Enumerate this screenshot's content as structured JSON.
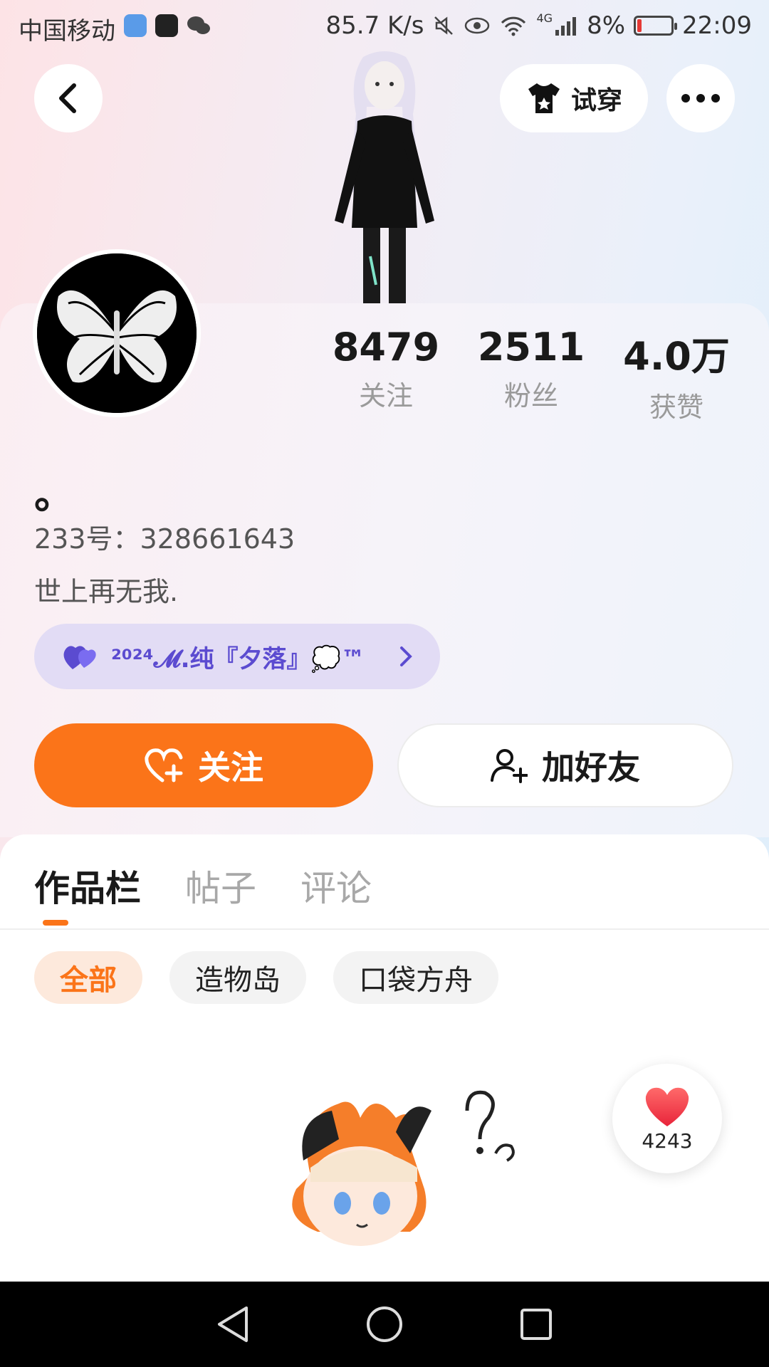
{
  "status_bar": {
    "carrier": "中国移动",
    "net_speed": "85.7 K/s",
    "network": "4G",
    "battery_percent": "8%",
    "battery_level": 0.08,
    "time": "22:09"
  },
  "header": {
    "tryon_label": "试穿"
  },
  "profile": {
    "stats": [
      {
        "value": "8479",
        "label": "关注"
      },
      {
        "value": "2511",
        "label": "粉丝"
      },
      {
        "value": "4.0万",
        "label": "获赞"
      }
    ],
    "username": "。",
    "uid": "233号：328661643",
    "bio": "世上再无我.",
    "tag": "²⁰²⁴𝓜.纯『夕落』💭™"
  },
  "actions": {
    "follow_label": "关注",
    "add_friend_label": "加好友"
  },
  "tabs": [
    {
      "label": "作品栏",
      "active": true
    },
    {
      "label": "帖子",
      "active": false
    },
    {
      "label": "评论",
      "active": false
    }
  ],
  "filters": [
    {
      "label": "全部",
      "active": true
    },
    {
      "label": "造物岛",
      "active": false
    },
    {
      "label": "口袋方舟",
      "active": false
    }
  ],
  "like_bubble": {
    "count": "4243"
  },
  "colors": {
    "accent": "#fb7419",
    "tag_text": "#5b4bd0",
    "tag_bg": "#e2dcf5"
  },
  "icons": [
    "back-icon",
    "tshirt-icon",
    "more-icon",
    "heart-plus-icon",
    "add-user-icon",
    "heart-icon",
    "nav-back-icon",
    "nav-home-icon",
    "nav-recents-icon"
  ]
}
